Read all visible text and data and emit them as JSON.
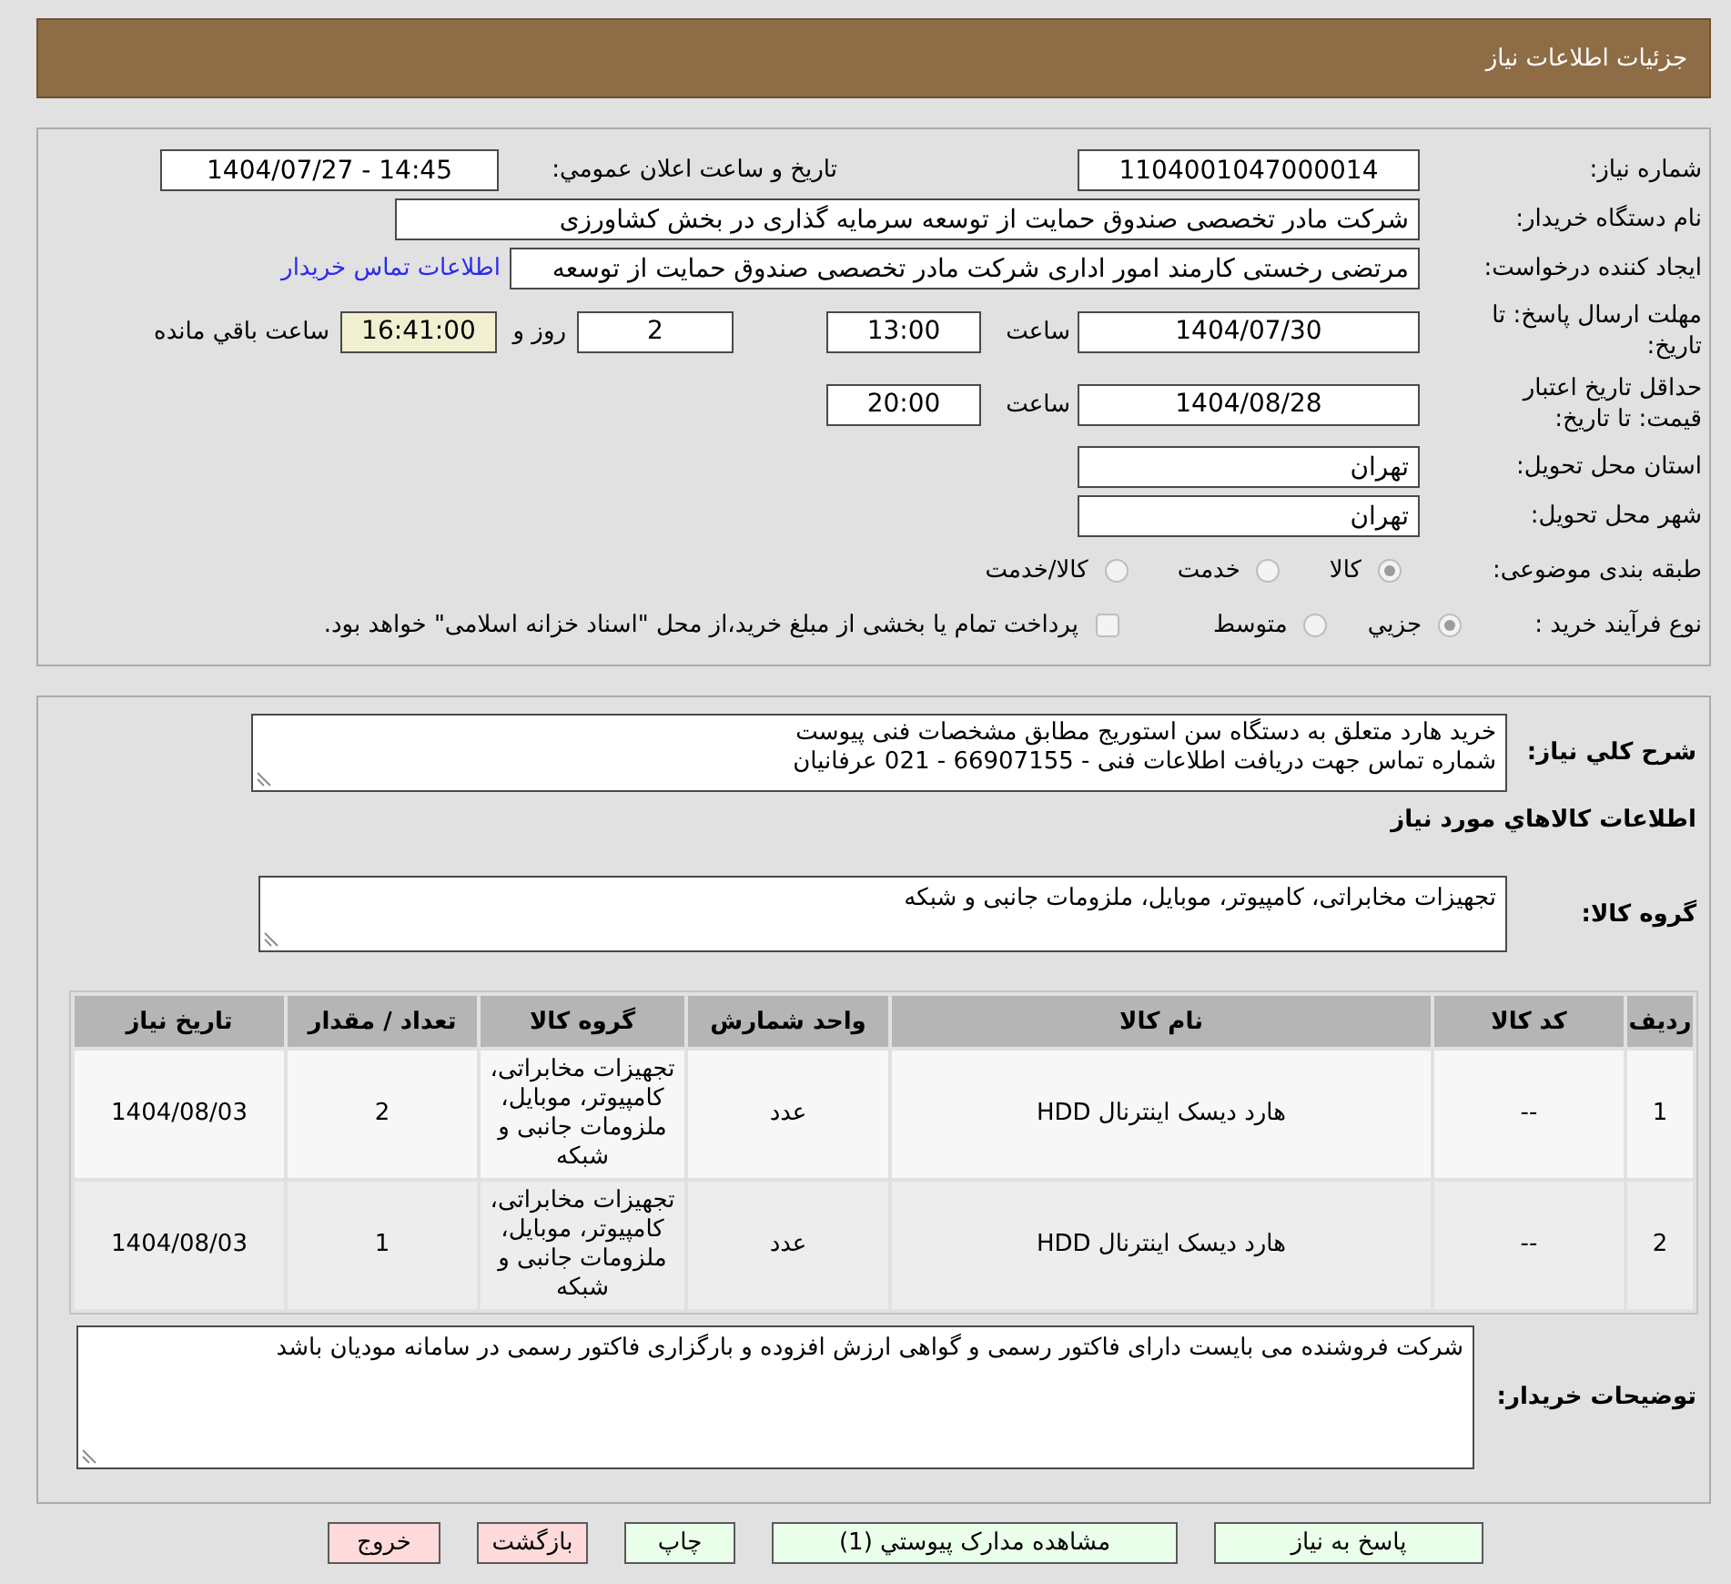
{
  "header": {
    "title": "جزئیات اطلاعات نیاز"
  },
  "details": {
    "need_number": {
      "label": "شماره نیاز:",
      "value": "1104001047000014"
    },
    "announcement": {
      "label": "تاریخ و ساعت اعلان عمومي:",
      "value": "1404/07/27 - 14:45"
    },
    "buyer_org": {
      "label": "نام دستگاه خریدار:",
      "value": "شرکت مادر تخصصی صندوق حمایت از توسعه سرمایه گذاری در بخش کشاورزی"
    },
    "requester": {
      "label": "ایجاد کننده درخواست:",
      "value": "مرتضی رخستی کارمند امور اداری شرکت مادر تخصصی صندوق حمایت از توسعه",
      "link": "اطلاعات تماس خریدار"
    },
    "reply_deadline": {
      "label": "مهلت ارسال پاسخ: تا تاریخ:",
      "date": "1404/07/30",
      "time_label": "ساعت",
      "time": "13:00",
      "days": "2",
      "days_label": "روز و",
      "remaining": "16:41:00",
      "remaining_label": "ساعت باقي مانده"
    },
    "price_validity": {
      "label": "حداقل تاریخ اعتبار قیمت: تا تاریخ:",
      "date": "1404/08/28",
      "time_label": "ساعت",
      "time": "20:00"
    },
    "province": {
      "label": "استان محل تحویل:",
      "value": "تهران"
    },
    "city": {
      "label": "شهر محل تحویل:",
      "value": "تهران"
    },
    "category": {
      "label": "طبقه بندی موضوعی:",
      "options": [
        {
          "label": "کالا",
          "selected": true
        },
        {
          "label": "خدمت",
          "selected": false
        },
        {
          "label": "کالا/خدمت",
          "selected": false
        }
      ]
    },
    "purchase_type": {
      "label": "نوع فرآیند خرید :",
      "options": [
        {
          "label": "جزيي",
          "selected": true
        },
        {
          "label": "متوسط",
          "selected": false
        }
      ],
      "treasury": {
        "label": "پرداخت تمام یا بخشی از مبلغ خرید،از محل \"اسناد خزانه اسلامی\" خواهد بود.",
        "checked": false
      }
    }
  },
  "goods": {
    "description": {
      "label": "شرح کلي نیاز:",
      "lines": [
        "خرید هارد متعلق به دستگاه سن استوریج مطابق مشخصات فنی پیوست",
        "شماره تماس جهت دریافت اطلاعات فنی - 66907155 - 021 عرفانیان"
      ]
    },
    "section_title": "اطلاعات کالاهاي مورد نیاز",
    "group": {
      "label": "گروه کالا:",
      "value": "تجهیزات مخابراتی، کامپیوتر، موبایل، ملزومات جانبی و شبکه"
    },
    "table": {
      "columns": [
        "ردیف",
        "کد کالا",
        "نام کالا",
        "واحد شمارش",
        "گروه کالا",
        "تعداد / مقدار",
        "تاریخ نیاز"
      ],
      "rows": [
        [
          "1",
          "--",
          "هارد دیسک اینترنال HDD",
          "عدد",
          "تجهیزات مخابراتی، کامپیوتر، موبایل، ملزومات جانبی و شبکه",
          "2",
          "1404/08/03"
        ],
        [
          "2",
          "--",
          "هارد دیسک اینترنال HDD",
          "عدد",
          "تجهیزات مخابراتی، کامپیوتر، موبایل، ملزومات جانبی و شبکه",
          "1",
          "1404/08/03"
        ]
      ]
    },
    "buyer_notes": {
      "label": "توضیحات خریدار:",
      "value": "شرکت فروشنده می بایست دارای فاکتور رسمی و گواهی ارزش افزوده و بارگزاری فاکتور رسمی در سامانه مودیان باشد"
    }
  },
  "buttons": [
    {
      "label": "پاسخ به نیاز",
      "kind": "proceed"
    },
    {
      "label": "مشاهده مدارک پیوستي (1)",
      "kind": "proceed"
    },
    {
      "label": "چاپ",
      "kind": "proceed"
    },
    {
      "label": "بازگشت",
      "kind": "leave"
    },
    {
      "label": "خروج",
      "kind": "leave"
    }
  ]
}
